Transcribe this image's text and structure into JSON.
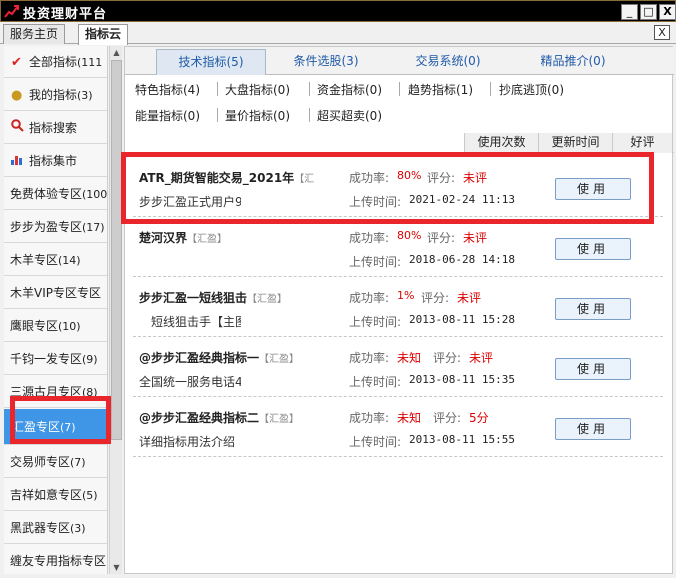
{
  "window": {
    "title": "投资理财平台",
    "minimize": "_",
    "maximize": "□",
    "close": "X"
  },
  "tabs": [
    {
      "label": "服务主页"
    },
    {
      "label": "指标云"
    }
  ],
  "tabs_close": "X",
  "sidebar": {
    "items": [
      {
        "label": "全部指标",
        "count": "(111",
        "icon": "check-icon"
      },
      {
        "label": "我的指标",
        "count": "(3)",
        "icon": "coins-icon"
      },
      {
        "label": "指标搜索",
        "count": "",
        "icon": "magnifier-icon"
      },
      {
        "label": "指标集市",
        "count": "",
        "icon": "bar-chart-icon"
      },
      {
        "label": "免费体验专区",
        "count": "(100"
      },
      {
        "label": "步步为盈专区",
        "count": "(17)"
      },
      {
        "label": "木羊专区",
        "count": "(14)"
      },
      {
        "label": "木羊VIP专区专区",
        "count": ""
      },
      {
        "label": "鹰眼专区",
        "count": "(10)"
      },
      {
        "label": "千钧一发专区",
        "count": "(9)"
      },
      {
        "label": "三源古月专区",
        "count": "(8)"
      },
      {
        "label": "汇盈专区",
        "count": "(7)"
      },
      {
        "label": "交易师专区",
        "count": "(7)"
      },
      {
        "label": "吉祥如意专区",
        "count": "(5)"
      },
      {
        "label": "黑武器专区",
        "count": "(3)"
      },
      {
        "label": "缠友专用指标专区",
        "count": ""
      }
    ]
  },
  "main_tabs": [
    {
      "label": "技术指标(5)"
    },
    {
      "label": "条件选股(3)"
    },
    {
      "label": "交易系统(0)"
    },
    {
      "label": "精品推介(0)"
    }
  ],
  "categories": [
    {
      "label": "特色指标(4)"
    },
    {
      "label": "大盘指标(0)"
    },
    {
      "label": "资金指标(0)"
    },
    {
      "label": "趋势指标(1)"
    },
    {
      "label": "抄底逃顶(0)"
    },
    {
      "label": "能量指标(0)"
    },
    {
      "label": "量价指标(0)"
    },
    {
      "label": "超买超卖(0)"
    }
  ],
  "sort": {
    "uses": "使用次数",
    "updated": "更新时间",
    "rating": "好评"
  },
  "labels": {
    "rate": "成功率:",
    "score": "评分:",
    "upload": "上传时间:",
    "use_button": "使用"
  },
  "indicators": [
    {
      "name": "ATR_期货智能交易_2021年",
      "tag": "【汇",
      "desc": "步步汇盈正式用户9",
      "rate": "80%",
      "score": "未评",
      "upload_time": "2021-02-24 11:13"
    },
    {
      "name": "楚河汉界",
      "tag": "【汇盈】",
      "desc": "",
      "rate": "80%",
      "score": "未评",
      "upload_time": "2018-06-28 14:18"
    },
    {
      "name": "步步汇盈一短线狙击",
      "tag": "【汇盈】",
      "desc": "短线狙击手【主图",
      "rate": "1%",
      "score": "未评",
      "upload_time": "2013-08-11 15:28"
    },
    {
      "name": "@步步汇盈经典指标一",
      "tag": "【汇盈】",
      "desc": "全国统一服务电话4",
      "rate": "未知",
      "score": "未评",
      "upload_time": "2013-08-11 15:35"
    },
    {
      "name": "@步步汇盈经典指标二",
      "tag": "【汇盈】",
      "desc": "详细指标用法介绍",
      "rate": "未知",
      "score": "5分",
      "upload_time": "2013-08-11 15:55"
    }
  ],
  "colors": {
    "selected_sidebar": "#3f95e6",
    "highlight": "#e8262b",
    "value_red": "#dd0000",
    "tab_text": "#1f5aa8"
  }
}
